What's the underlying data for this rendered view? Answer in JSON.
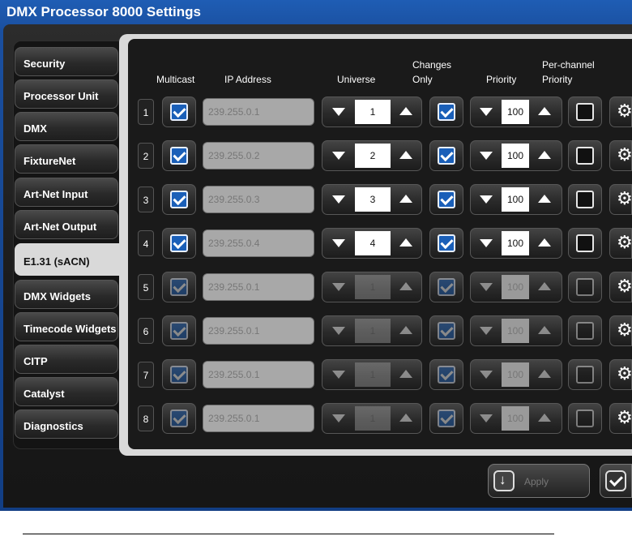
{
  "window": {
    "title": "DMX Processor 8000 Settings"
  },
  "sidebar": {
    "items": [
      {
        "label": "Security"
      },
      {
        "label": "Processor Unit"
      },
      {
        "label": "DMX"
      },
      {
        "label": "FixtureNet"
      },
      {
        "label": "Art-Net Input"
      },
      {
        "label": "Art-Net Output"
      },
      {
        "label": "E1.31 (sACN)",
        "active": true
      },
      {
        "label": "DMX Widgets"
      },
      {
        "label": "Timecode Widgets"
      },
      {
        "label": "CITP"
      },
      {
        "label": "Catalyst"
      },
      {
        "label": "Diagnostics"
      }
    ]
  },
  "table": {
    "headers": {
      "multicast": "Multicast",
      "ip": "IP Address",
      "universe": "Universe",
      "changes_1": "Changes",
      "changes_2": "Only",
      "priority": "Priority",
      "perchan_1": "Per-channel",
      "perchan_2": "Priority"
    },
    "rows": [
      {
        "num": "1",
        "multicast": true,
        "ip": "239.255.0.1",
        "universe": "1",
        "changes_only": true,
        "priority": "100",
        "per_channel": false,
        "enabled": true
      },
      {
        "num": "2",
        "multicast": true,
        "ip": "239.255.0.2",
        "universe": "2",
        "changes_only": true,
        "priority": "100",
        "per_channel": false,
        "enabled": true
      },
      {
        "num": "3",
        "multicast": true,
        "ip": "239.255.0.3",
        "universe": "3",
        "changes_only": true,
        "priority": "100",
        "per_channel": false,
        "enabled": true
      },
      {
        "num": "4",
        "multicast": true,
        "ip": "239.255.0.4",
        "universe": "4",
        "changes_only": true,
        "priority": "100",
        "per_channel": false,
        "enabled": true
      },
      {
        "num": "5",
        "multicast": true,
        "ip": "239.255.0.1",
        "universe": "1",
        "changes_only": true,
        "priority": "100",
        "per_channel": false,
        "enabled": false
      },
      {
        "num": "6",
        "multicast": true,
        "ip": "239.255.0.1",
        "universe": "1",
        "changes_only": true,
        "priority": "100",
        "per_channel": false,
        "enabled": false
      },
      {
        "num": "7",
        "multicast": true,
        "ip": "239.255.0.1",
        "universe": "1",
        "changes_only": true,
        "priority": "100",
        "per_channel": false,
        "enabled": false
      },
      {
        "num": "8",
        "multicast": true,
        "ip": "239.255.0.1",
        "universe": "1",
        "changes_only": true,
        "priority": "100",
        "per_channel": false,
        "enabled": false
      }
    ]
  },
  "footer": {
    "apply_label": "Apply"
  },
  "icons": {
    "row_settings": "gear-icon",
    "apply": "arrow-down-icon",
    "ok": "checkmark-icon"
  },
  "colors": {
    "title_bar": "#1a4f9f",
    "checkbox_on": "#1a5fb8",
    "panel_bg": "#1a1a1a"
  }
}
